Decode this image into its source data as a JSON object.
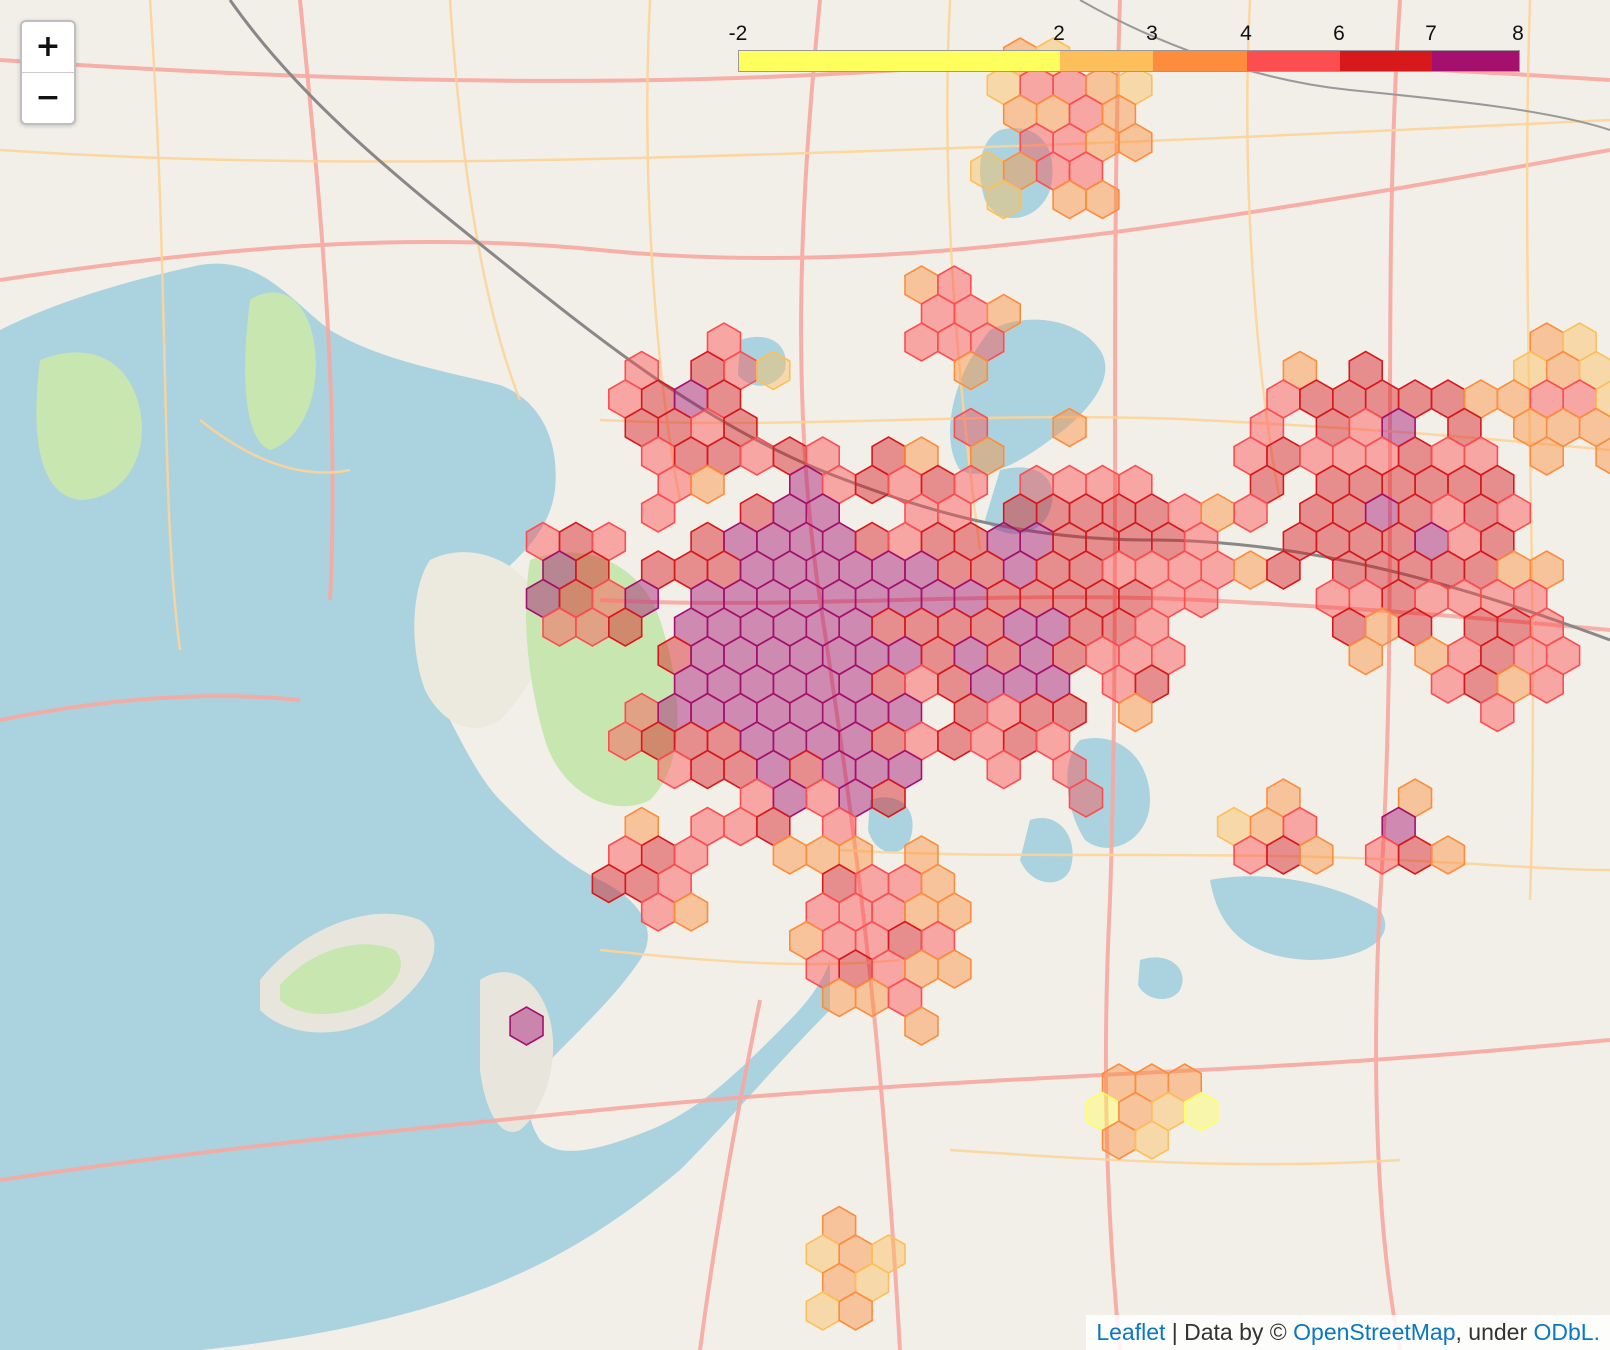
{
  "zoom": {
    "in_label": "+",
    "out_label": "−"
  },
  "legend": {
    "ticks": [
      "-2",
      "2",
      "3",
      "4",
      "6",
      "7",
      "8"
    ],
    "colors": [
      "#ffff5e",
      "#fdbf5a",
      "#fd8d3c",
      "#fc4e50",
      "#d7191c",
      "#a50f6e"
    ]
  },
  "attribution": {
    "leaflet": "Leaflet",
    "separator": " | Data by © ",
    "osm": "OpenStreetMap",
    "under": ", under ",
    "odbl": "ODbL."
  },
  "colors": {
    "land": "#f2efe9",
    "water": "#aad3df",
    "park": "#c8e6b0",
    "road_major": "#f7a8a0",
    "road_minor": "#fcd49a",
    "railway": "#888888"
  }
}
